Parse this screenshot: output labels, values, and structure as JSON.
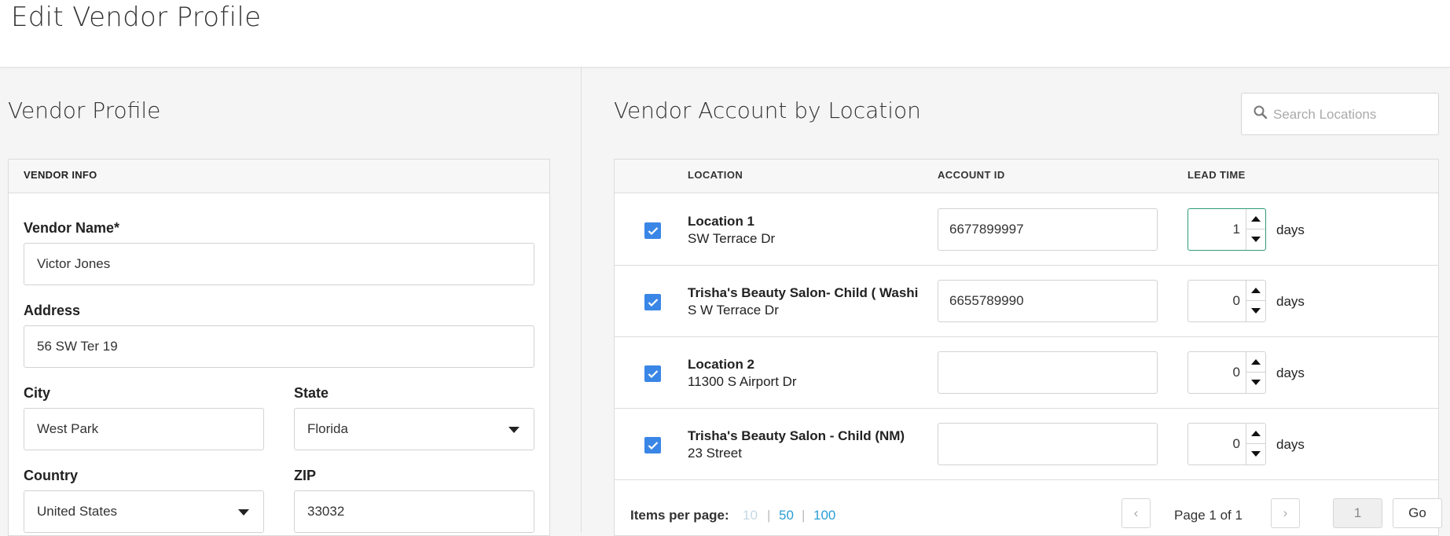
{
  "header": {
    "title": "Edit Vendor Profile"
  },
  "left": {
    "section_title": "Vendor Profile",
    "card_header": "VENDOR INFO",
    "fields": {
      "vendor_name": {
        "label": "Vendor Name*",
        "value": "Victor Jones"
      },
      "address": {
        "label": "Address",
        "value": "56 SW Ter 19"
      },
      "city": {
        "label": "City",
        "value": "West Park"
      },
      "state": {
        "label": "State",
        "value": "Florida"
      },
      "country": {
        "label": "Country",
        "value": "United States"
      },
      "zip": {
        "label": "ZIP",
        "value": "33032"
      }
    }
  },
  "right": {
    "section_title": "Vendor Account by Location",
    "search": {
      "placeholder": "Search Locations",
      "icon": "search-icon"
    },
    "columns": {
      "location": "LOCATION",
      "account_id": "ACCOUNT ID",
      "lead_time": "LEAD TIME"
    },
    "rows": [
      {
        "checked": true,
        "name": "Location 1",
        "address": "SW Terrace Dr",
        "account_id": "6677899997",
        "lead_time": "1",
        "unit": "days",
        "focused": true
      },
      {
        "checked": true,
        "name": "Trisha's Beauty Salon- Child ( Washi",
        "address": "S W Terrace Dr",
        "account_id": "6655789990",
        "lead_time": "0",
        "unit": "days",
        "focused": false
      },
      {
        "checked": true,
        "name": "Location 2",
        "address": "11300 S Airport Dr",
        "account_id": "",
        "lead_time": "0",
        "unit": "days",
        "focused": false
      },
      {
        "checked": true,
        "name": "Trisha's Beauty Salon - Child (NM)",
        "address": "23 Street",
        "account_id": "",
        "lead_time": "0",
        "unit": "days",
        "focused": false
      }
    ],
    "pagination": {
      "items_per_page_label": "Items per page:",
      "options": [
        "10",
        "50",
        "100"
      ],
      "selected": "10",
      "page_info": "Page 1 of 1",
      "page_input": "1",
      "go_label": "Go"
    }
  },
  "colors": {
    "accent": "#3a86e6",
    "link": "#2a9fd6",
    "focus": "#2e9b7a"
  }
}
